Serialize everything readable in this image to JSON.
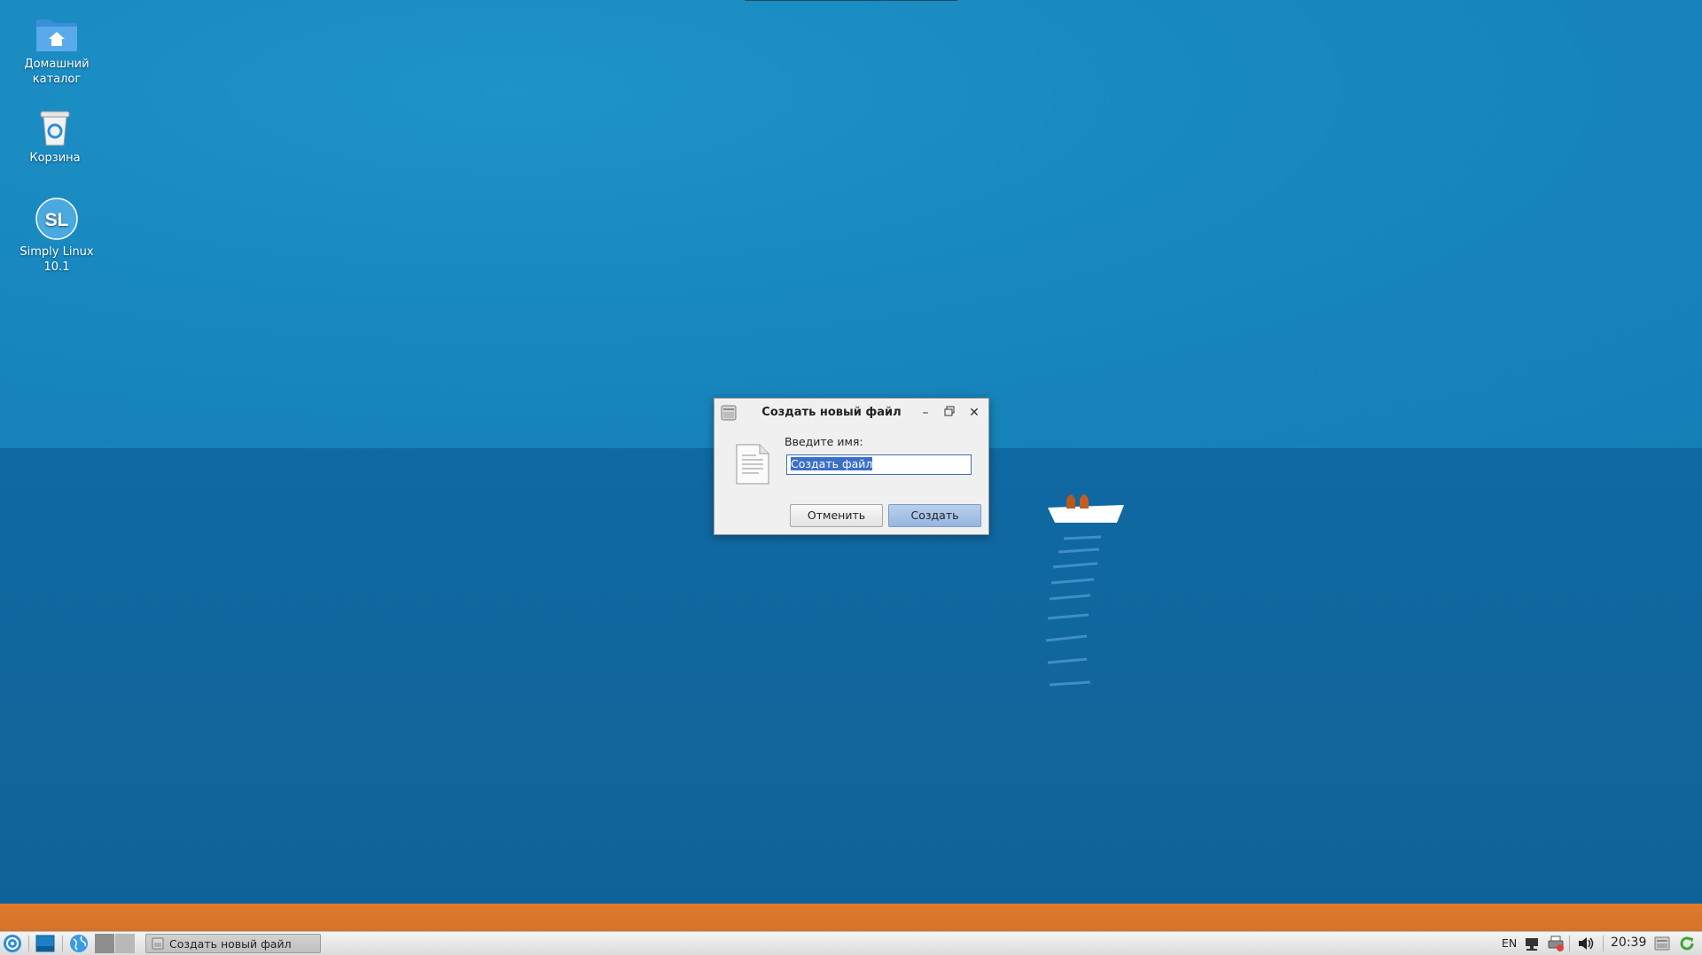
{
  "desktop": {
    "icons": [
      {
        "label": "Домашний каталог",
        "icon": "home-folder-icon"
      },
      {
        "label": "Корзина",
        "icon": "trash-icon"
      },
      {
        "label": "Simply Linux 10.1",
        "icon": "simply-linux-icon"
      }
    ]
  },
  "dialog": {
    "title": "Создать новый файл",
    "prompt": "Введите имя:",
    "input_value": "Создать файл",
    "cancel_label": "Отменить",
    "create_label": "Создать",
    "icons": [
      "file-manager-icon",
      "minimize-icon",
      "restore-icon",
      "close-icon",
      "text-document-icon"
    ]
  },
  "taskbar": {
    "task_label": "Создать новый файл",
    "language": "EN",
    "clock": "20:39",
    "icons": [
      "start-menu-icon",
      "show-desktop-icon",
      "web-browser-icon",
      "workspace-pager",
      "network-icon",
      "printer-icon",
      "volume-icon",
      "file-manager-icon",
      "update-icon"
    ]
  },
  "colors": {
    "sky": "#1786bd",
    "sea": "#0f69a3",
    "sand": "#e07a2c",
    "selection": "#3b6fc7",
    "create_button": "#a8c3e8"
  }
}
